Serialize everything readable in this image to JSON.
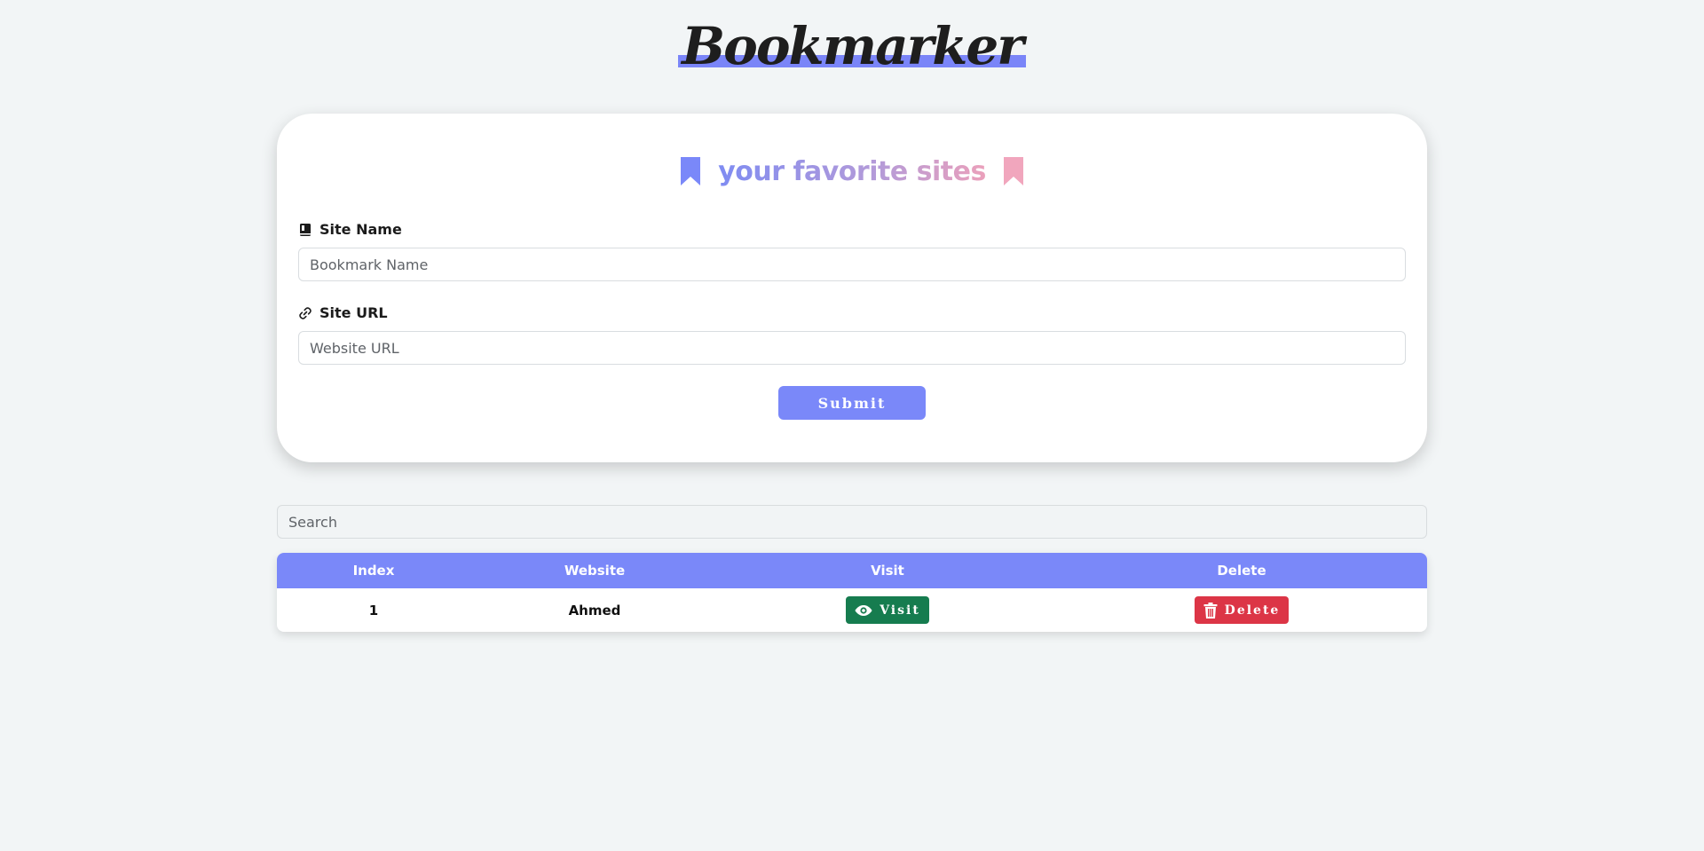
{
  "app_title": "Bookmarker",
  "card": {
    "heading": "your favorite sites",
    "site_name_label": "Site Name",
    "site_name_placeholder": "Bookmark Name",
    "site_url_label": "Site URL",
    "site_url_placeholder": "Website URL",
    "submit_label": "Submit"
  },
  "search": {
    "placeholder": "Search"
  },
  "table": {
    "headers": [
      "Index",
      "Website",
      "Visit",
      "Delete"
    ],
    "rows": [
      {
        "index": "1",
        "website": "Ahmed",
        "visit_label": "Visit",
        "delete_label": "Delete"
      }
    ]
  },
  "colors": {
    "accent": "#7a88f9",
    "visit": "#167c4f",
    "delete": "#dc3546",
    "bookmark_left": "#7a88f9",
    "bookmark_right": "#f1a6bd"
  },
  "icons": {
    "heading_left": "bookmark-icon",
    "heading_right": "bookmark-icon",
    "site_name": "book-icon",
    "site_url": "link-icon",
    "visit": "eye-icon",
    "delete": "trash-icon"
  }
}
